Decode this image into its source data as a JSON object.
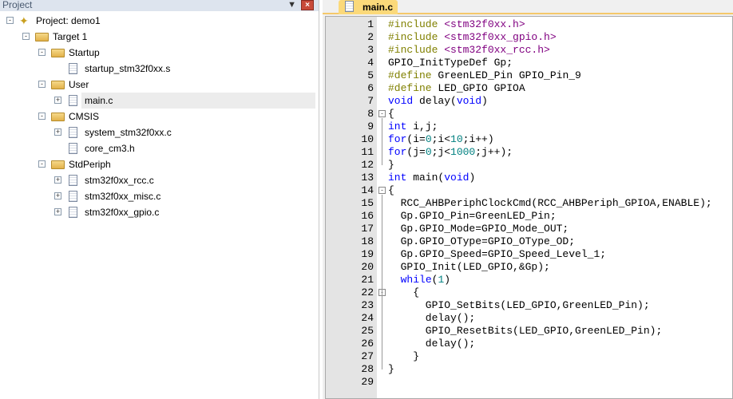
{
  "project_panel": {
    "title": "Project",
    "pin_icon": "pin-icon",
    "close_icon": "close-icon",
    "tree": [
      {
        "label": "Project: demo1",
        "level": 0,
        "icon": "project",
        "expander": "-"
      },
      {
        "label": "Target 1",
        "level": 1,
        "icon": "folder",
        "expander": "-"
      },
      {
        "label": "Startup",
        "level": 2,
        "icon": "folder",
        "expander": "-"
      },
      {
        "label": "startup_stm32f0xx.s",
        "level": 3,
        "icon": "file",
        "expander": ""
      },
      {
        "label": "User",
        "level": 2,
        "icon": "folder",
        "expander": "-"
      },
      {
        "label": "main.c",
        "level": 3,
        "icon": "file",
        "expander": "+",
        "selected": true
      },
      {
        "label": "CMSIS",
        "level": 2,
        "icon": "folder",
        "expander": "-"
      },
      {
        "label": "system_stm32f0xx.c",
        "level": 3,
        "icon": "file",
        "expander": "+"
      },
      {
        "label": "core_cm3.h",
        "level": 3,
        "icon": "file",
        "expander": ""
      },
      {
        "label": "StdPeriph",
        "level": 2,
        "icon": "folder",
        "expander": "-"
      },
      {
        "label": "stm32f0xx_rcc.c",
        "level": 3,
        "icon": "file",
        "expander": "+"
      },
      {
        "label": "stm32f0xx_misc.c",
        "level": 3,
        "icon": "file",
        "expander": "+"
      },
      {
        "label": "stm32f0xx_gpio.c",
        "level": 3,
        "icon": "file",
        "expander": "+"
      }
    ]
  },
  "editor": {
    "tab": "main.c",
    "colors": {
      "preprocessor": "#808000",
      "include": "#800080",
      "keyword": "#0000ff",
      "number": "#008080"
    },
    "lines": [
      [
        [
          "#include ",
          "pp"
        ],
        [
          "<stm32f0xx.h>",
          "inc"
        ]
      ],
      [
        [
          "#include ",
          "pp"
        ],
        [
          "<stm32f0xx_gpio.h>",
          "inc"
        ]
      ],
      [
        [
          "#include ",
          "pp"
        ],
        [
          "<stm32f0xx_rcc.h>",
          "inc"
        ]
      ],
      [
        [
          "GPIO_InitTypeDef Gp;",
          "id"
        ]
      ],
      [
        [
          "#define ",
          "pp"
        ],
        [
          "GreenLED_Pin GPIO_Pin_9",
          "id"
        ]
      ],
      [
        [
          "#define ",
          "pp"
        ],
        [
          "LED_GPIO GPIOA",
          "id"
        ]
      ],
      [
        [
          "void",
          "kw"
        ],
        [
          " delay(",
          "id"
        ],
        [
          "void",
          "kw"
        ],
        [
          ")",
          "id"
        ]
      ],
      [
        [
          "{",
          "id"
        ]
      ],
      [
        [
          "int",
          "kw"
        ],
        [
          " i,j;",
          "id"
        ]
      ],
      [
        [
          "for",
          "kw"
        ],
        [
          "(i=",
          "id"
        ],
        [
          "0",
          "num"
        ],
        [
          ";i<",
          "id"
        ],
        [
          "10",
          "num"
        ],
        [
          ";i++)",
          "id"
        ]
      ],
      [
        [
          "for",
          "kw"
        ],
        [
          "(j=",
          "id"
        ],
        [
          "0",
          "num"
        ],
        [
          ";j<",
          "id"
        ],
        [
          "1000",
          "num"
        ],
        [
          ";j++);",
          "id"
        ]
      ],
      [
        [
          "}",
          "id"
        ]
      ],
      [
        [
          "int",
          "kw"
        ],
        [
          " main(",
          "id"
        ],
        [
          "void",
          "kw"
        ],
        [
          ")",
          "id"
        ]
      ],
      [
        [
          "{",
          "id"
        ]
      ],
      [
        [
          "  RCC_AHBPeriphClockCmd(RCC_AHBPeriph_GPIOA,ENABLE);",
          "id"
        ]
      ],
      [
        [
          "  Gp.GPIO_Pin=GreenLED_Pin;",
          "id"
        ]
      ],
      [
        [
          "  Gp.GPIO_Mode=GPIO_Mode_OUT;",
          "id"
        ]
      ],
      [
        [
          "  Gp.GPIO_OType=GPIO_OType_OD;",
          "id"
        ]
      ],
      [
        [
          "  Gp.GPIO_Speed=GPIO_Speed_Level_1;",
          "id"
        ]
      ],
      [
        [
          "  GPIO_Init(LED_GPIO,&Gp);",
          "id"
        ]
      ],
      [
        [
          "  ",
          "id"
        ],
        [
          "while",
          "kw"
        ],
        [
          "(",
          "id"
        ],
        [
          "1",
          "num"
        ],
        [
          ")",
          "id"
        ]
      ],
      [
        [
          "    {",
          "id"
        ]
      ],
      [
        [
          "      GPIO_SetBits(LED_GPIO,GreenLED_Pin);",
          "id"
        ]
      ],
      [
        [
          "      delay();",
          "id"
        ]
      ],
      [
        [
          "      GPIO_ResetBits(LED_GPIO,GreenLED_Pin);",
          "id"
        ]
      ],
      [
        [
          "      delay();",
          "id"
        ]
      ],
      [
        [
          "    }",
          "id"
        ]
      ],
      [
        [
          "}",
          "id"
        ]
      ],
      []
    ],
    "folds": {
      "8": "-",
      "14": "-",
      "22": "-"
    }
  }
}
